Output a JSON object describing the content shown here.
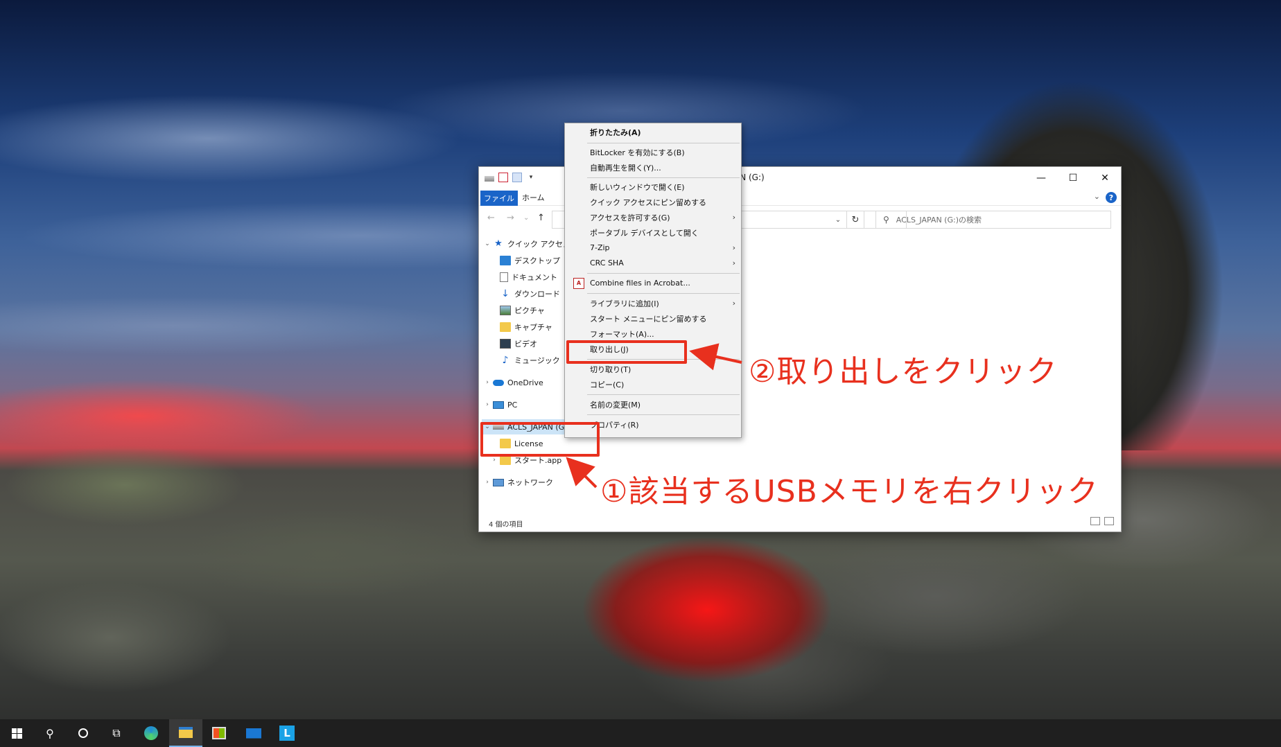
{
  "window": {
    "title": "AN (G:)",
    "controls": {
      "minimize": "—",
      "maximize": "☐",
      "close": "✕"
    }
  },
  "ribbon": {
    "file_tab": "ファイル",
    "home_tab": "ホーム",
    "chevron": "⌄",
    "help": "?"
  },
  "navbar": {
    "back": "←",
    "forward": "→",
    "recent": "⌄",
    "up": "↑",
    "address_dropdown": "⌄",
    "refresh": "↻",
    "search_placeholder": "ACLS_JAPAN (G:)の検索"
  },
  "tree": {
    "quick_access": "クイック アクセス",
    "desktop": "デスクトップ",
    "documents": "ドキュメント",
    "downloads": "ダウンロード",
    "pictures": "ピクチャ",
    "capture": "キャプチャ",
    "videos": "ビデオ",
    "music": "ミュージック",
    "onedrive": "OneDrive",
    "pc": "PC",
    "drive": "ACLS_JAPAN (G:)",
    "license": "License",
    "start_app": "スタート.app",
    "network": "ネットワーク"
  },
  "status": {
    "item_count": "4 個の項目"
  },
  "context_menu": {
    "collapse": "折りたたみ(A)",
    "bitlocker": "BitLocker を有効にする(B)",
    "autoplay": "自動再生を開く(Y)...",
    "new_window": "新しいウィンドウで開く(E)",
    "pin_quick": "クイック アクセスにピン留めする",
    "give_access": "アクセスを許可する(G)",
    "portable": "ポータブル デバイスとして開く",
    "zip7": "7-Zip",
    "crc": "CRC SHA",
    "acrobat": "Combine files in Acrobat...",
    "add_library": "ライブラリに追加(I)",
    "pin_start": "スタート メニューにピン留めする",
    "format": "フォーマット(A)...",
    "eject": "取り出し(J)",
    "cut": "切り取り(T)",
    "copy": "コピー(C)",
    "rename": "名前の変更(M)",
    "properties": "プロパティ(R)"
  },
  "annotations": {
    "step1": "①該当するUSBメモリを右クリック",
    "step2": "②取り出しをクリック"
  },
  "icons": {
    "search": "search-icon",
    "cortana": "cortana-icon",
    "task_view": "task-view-icon",
    "edge": "edge-icon",
    "file_explorer": "file-explorer-icon",
    "store": "store-icon",
    "mail": "mail-icon",
    "app_l": "l-app-icon"
  },
  "taskbar": {
    "app_l_letter": "L"
  },
  "colors": {
    "accent": "#1a64c8",
    "annotation": "#e8301e",
    "taskbar": "#1f1f1f"
  }
}
